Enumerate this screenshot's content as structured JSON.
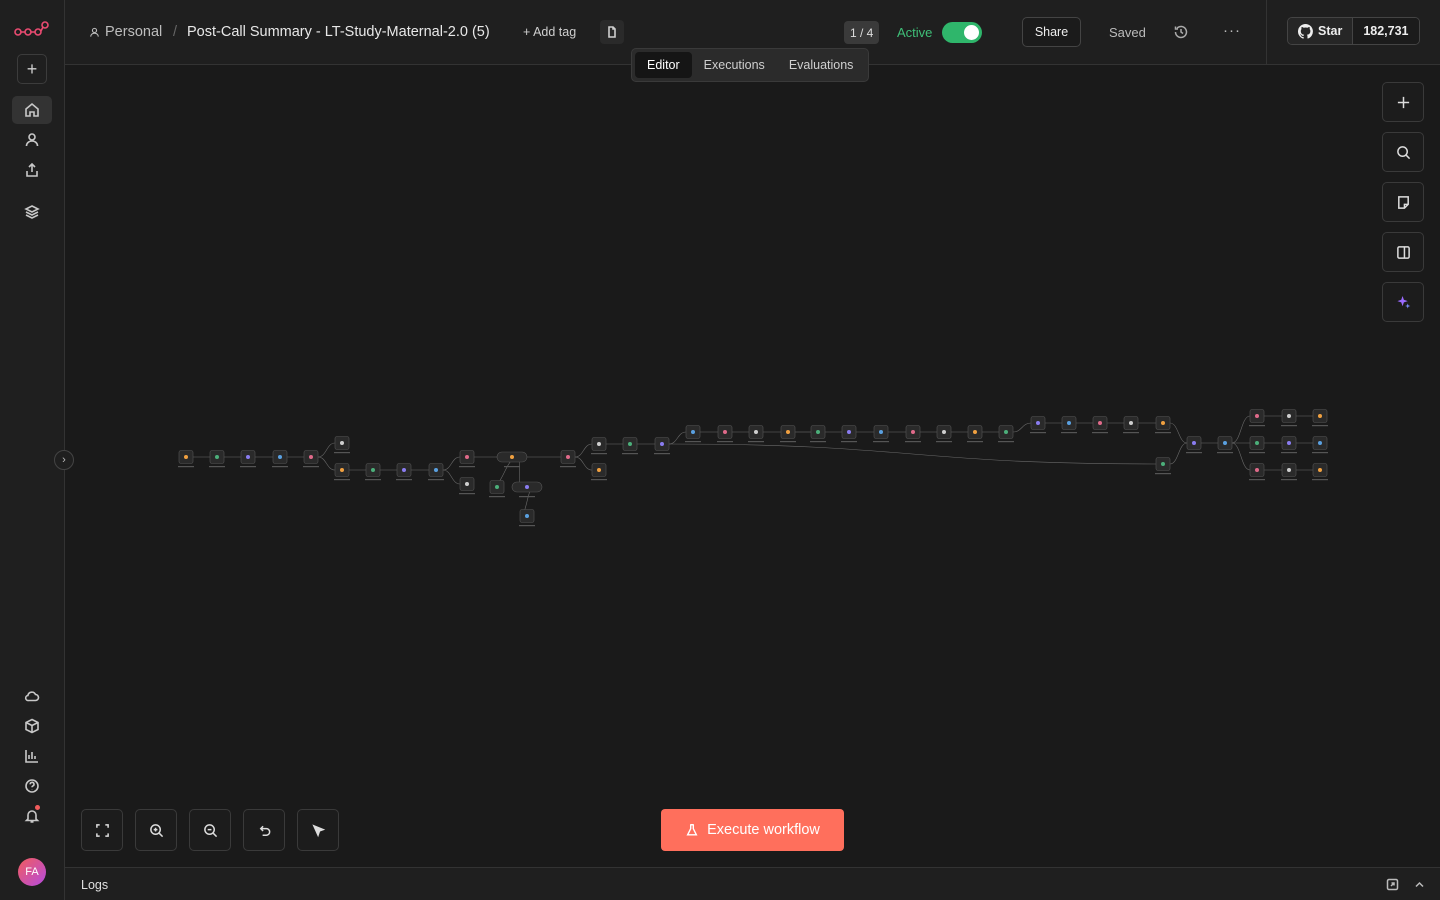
{
  "breadcrumb": {
    "project": "Personal",
    "separator": "/",
    "workflow_title": "Post-Call Summary - LT-Study-Maternal-2.0 (5)"
  },
  "header": {
    "add_tag": "+ Add tag",
    "page_indicator": "1 / 4",
    "active_label": "Active",
    "active_on": true,
    "share_label": "Share",
    "saved_label": "Saved",
    "more_label": "···",
    "github": {
      "star_label": "Star",
      "star_count": "182,731"
    }
  },
  "tabs": [
    {
      "label": "Editor",
      "active": true
    },
    {
      "label": "Executions",
      "active": false
    },
    {
      "label": "Evaluations",
      "active": false
    }
  ],
  "sidebar": {
    "avatar_initials": "FA",
    "top_items": [
      "home-icon",
      "user-icon",
      "share-icon",
      "layers-icon"
    ],
    "bottom_items": [
      "cloud-icon",
      "templates-icon",
      "insights-icon",
      "help-icon",
      "bell-icon"
    ]
  },
  "canvas_tools": {
    "right": [
      "add-node-icon",
      "search-icon",
      "sticky-note-icon",
      "panel-icon",
      "ai-sparkle-icon"
    ],
    "bottom": [
      "fit-view-icon",
      "zoom-in-icon",
      "zoom-out-icon",
      "undo-icon",
      "tidy-up-icon"
    ]
  },
  "execute_label": "Execute workflow",
  "logs_label": "Logs",
  "colors": {
    "accent": "#ff6f5c",
    "active_green": "#2fb66b",
    "background": "#1a1a1a"
  }
}
